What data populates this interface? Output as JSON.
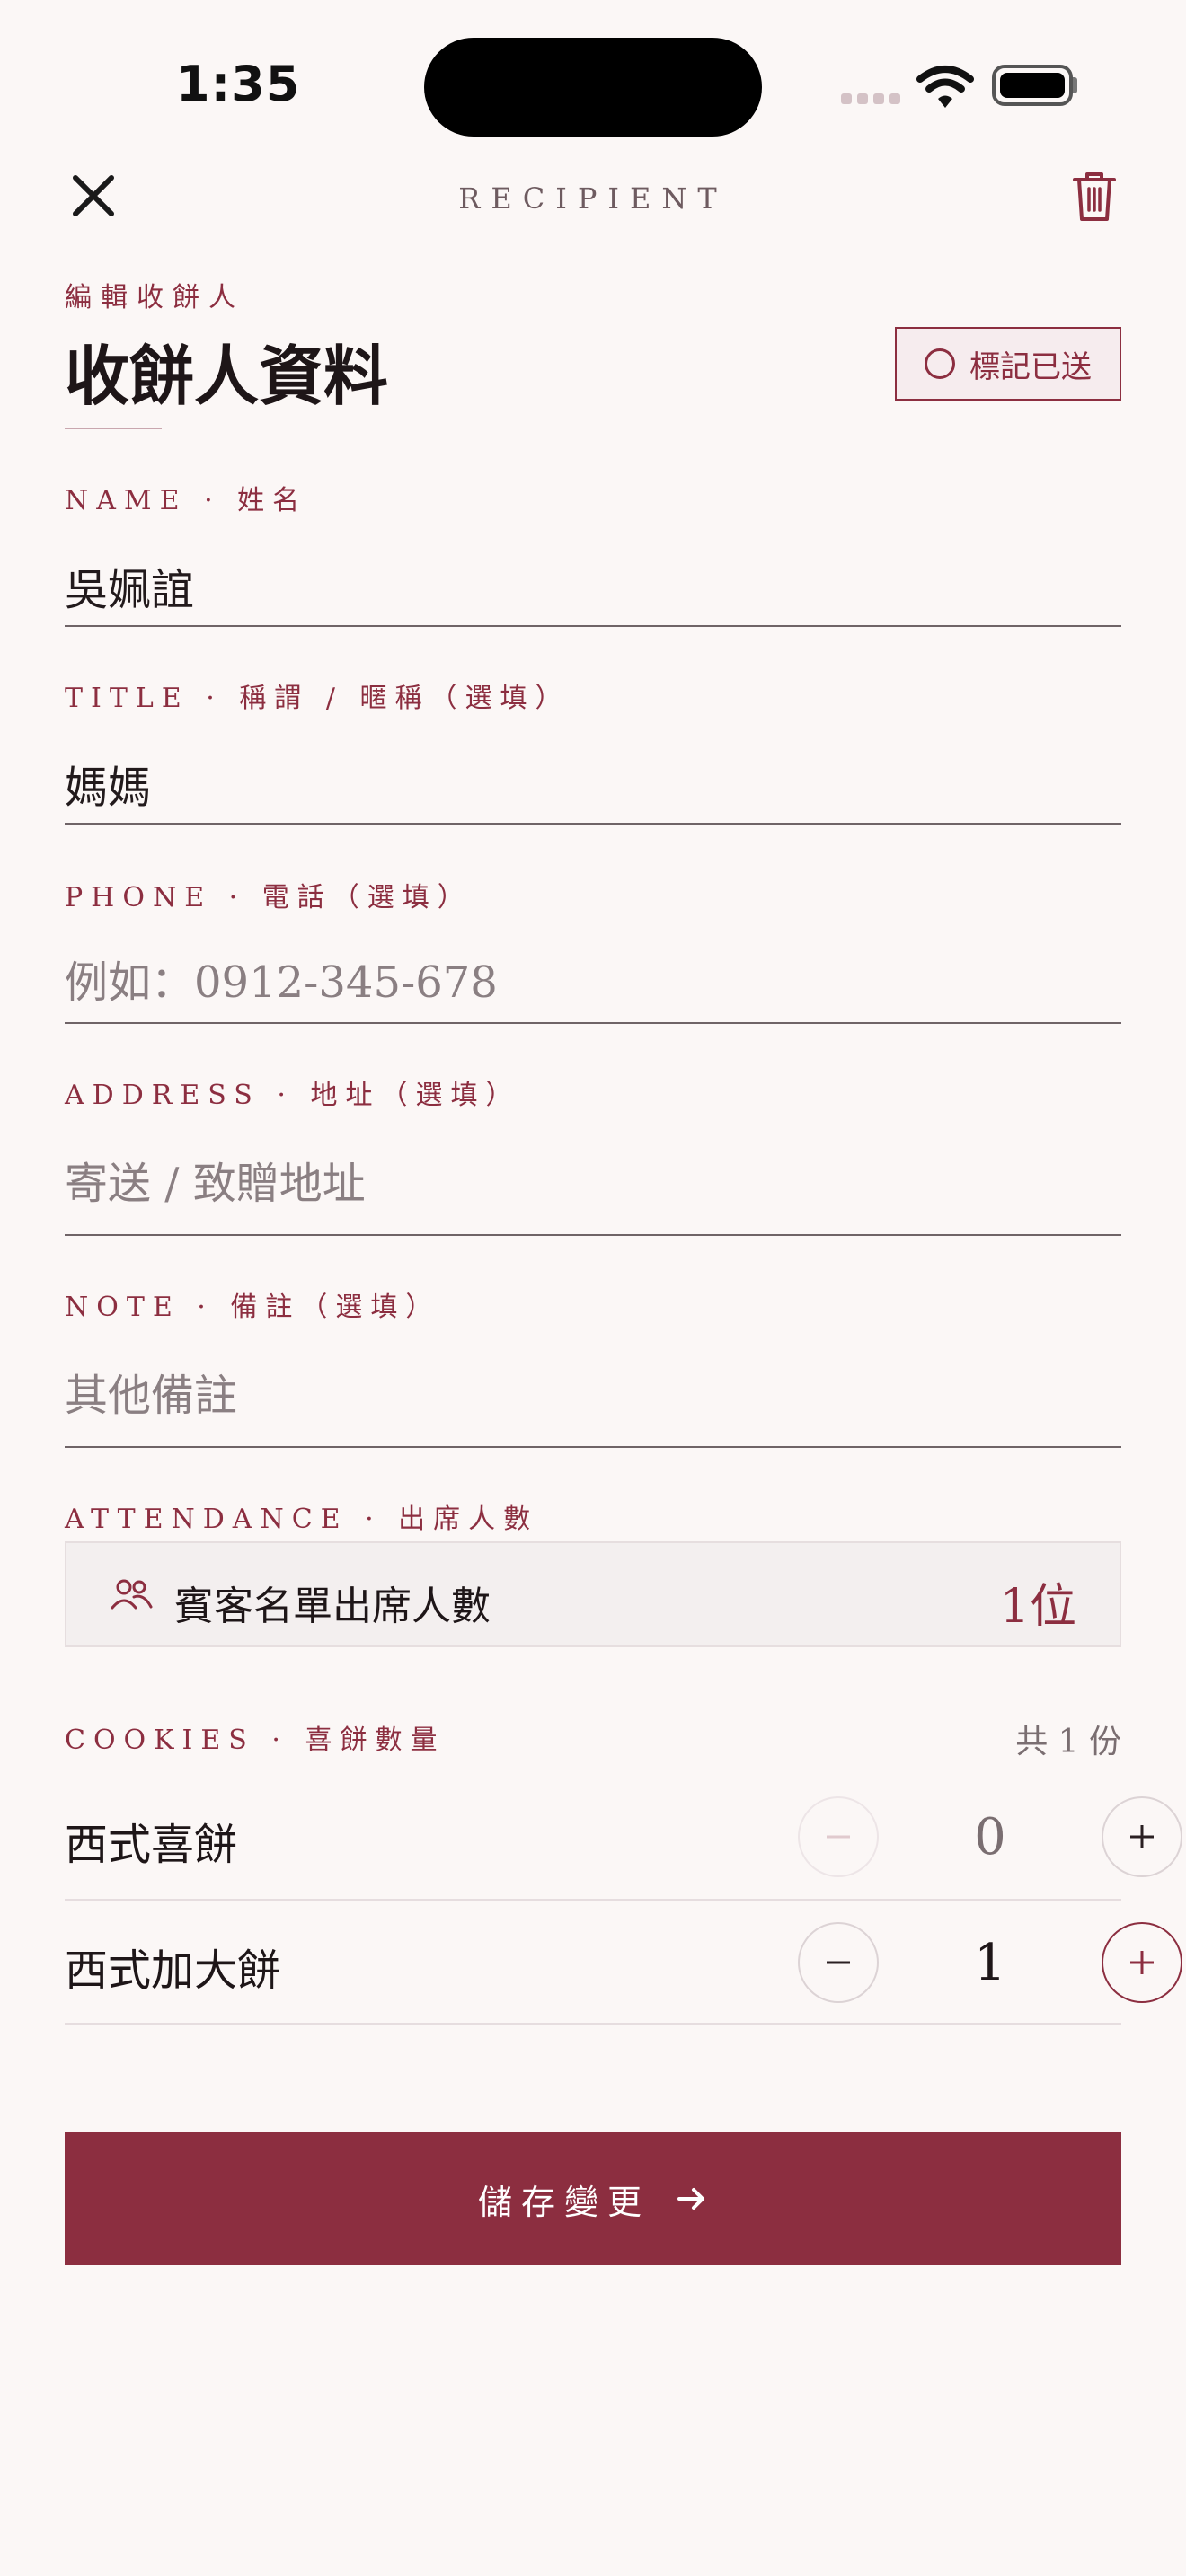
{
  "status_bar": {
    "time": "1:35"
  },
  "nav": {
    "title": "RECIPIENT"
  },
  "header": {
    "eyebrow": "編輯收餅人",
    "title": "收餅人資料",
    "mark_sent_label": "標記已送"
  },
  "fields": [
    {
      "label": "NAME · 姓名",
      "value": "吳姵誼",
      "placeholder": ""
    },
    {
      "label": "TITLE · 稱謂 / 暱稱（選填）",
      "value": "媽媽",
      "placeholder": ""
    },
    {
      "label": "PHONE · 電話（選填）",
      "value": "",
      "placeholder": "例如：0912-345-678"
    },
    {
      "label": "ADDRESS · 地址（選填）",
      "value": "",
      "placeholder": "寄送 / 致贈地址"
    },
    {
      "label": "NOTE · 備註（選填）",
      "value": "",
      "placeholder": "其他備註"
    }
  ],
  "attendance": {
    "label": "ATTENDANCE · 出席人數",
    "description": "賓客名單出席人數",
    "value": "1位"
  },
  "cookies": {
    "label": "COOKIES · 喜餅數量",
    "total": "共 1 份",
    "items": [
      {
        "name": "西式喜餅",
        "quantity": "0"
      },
      {
        "name": "西式加大餅",
        "quantity": "1"
      }
    ]
  },
  "save_button": {
    "label": "儲存變更"
  },
  "colors": {
    "accent": "#8C2E40",
    "background": "#FBF7F6",
    "text": "#1E1618",
    "placeholder": "#8A7F82"
  },
  "icons": [
    "close-icon",
    "trash-icon",
    "circle-icon",
    "people-icon",
    "minus-icon",
    "plus-icon",
    "arrow-right-icon",
    "wifi-icon",
    "battery-icon",
    "signal-icon"
  ]
}
